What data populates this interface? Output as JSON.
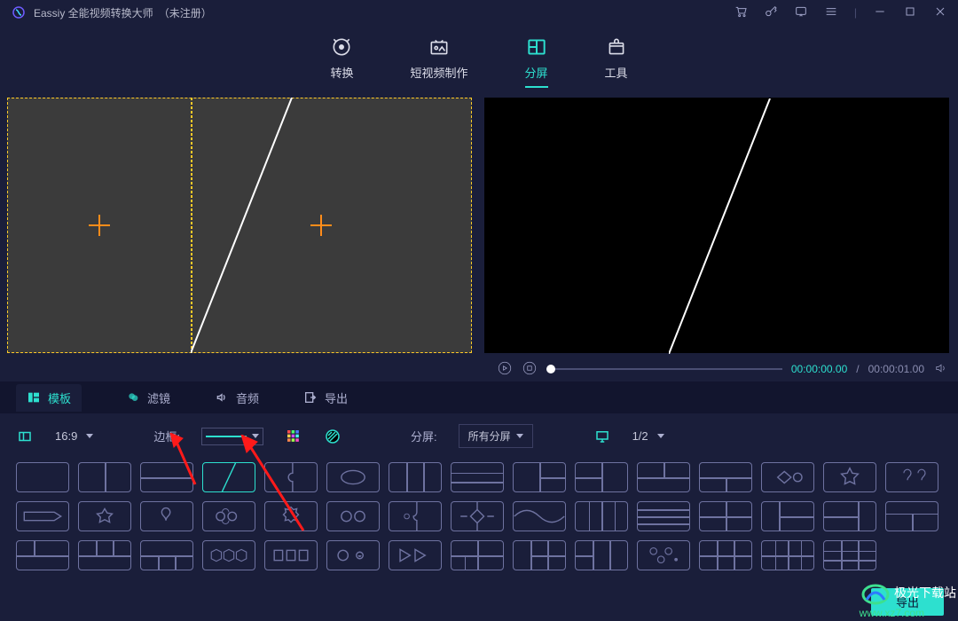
{
  "titlebar": {
    "app_name": "Eassiy 全能视频转换大师",
    "reg_status": "（未注册）"
  },
  "nav": {
    "convert": "转换",
    "shortvideo": "短视频制作",
    "split": "分屏",
    "tools": "工具"
  },
  "subtabs": {
    "template": "模板",
    "filter": "滤镜",
    "audio": "音频",
    "export": "导出"
  },
  "controls": {
    "aspect": "16:9",
    "border_label": "边框:",
    "split_label": "分屏:",
    "split_value": "所有分屏",
    "screen_value": "1/2"
  },
  "player": {
    "current": "00:00:00.00",
    "total": "00:00:01.00"
  },
  "bottom": {
    "export": "导出"
  },
  "watermark": {
    "title": "极光下载站",
    "url": "www.xz7.com"
  }
}
